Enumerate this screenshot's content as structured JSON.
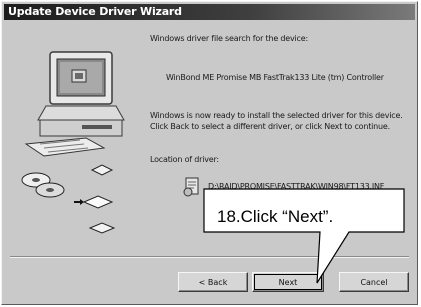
{
  "window": {
    "title": "Update Device Driver Wizard"
  },
  "content": {
    "search_line": "Windows driver file search for the device:",
    "device_name": "WinBond ME Promise MB FastTrak133 Lite (tm) Controller",
    "ready_text": "Windows is now ready to install the selected driver for this device. Click Back to select a different driver, or click Next to continue.",
    "location_label": "Location of driver:",
    "driver_path": "D:\\RAID\\PROMISE\\FASTTRAK\\WIN98\\FT133.INF",
    "driver_icon": "setup-file-icon"
  },
  "buttons": {
    "back": "< Back",
    "next": "Next",
    "cancel": "Cancel"
  },
  "annotation": {
    "text": "18.Click “Next”."
  },
  "illustration": {
    "computer_icon": "computer-icon",
    "disc_icons": "disc-icon"
  }
}
